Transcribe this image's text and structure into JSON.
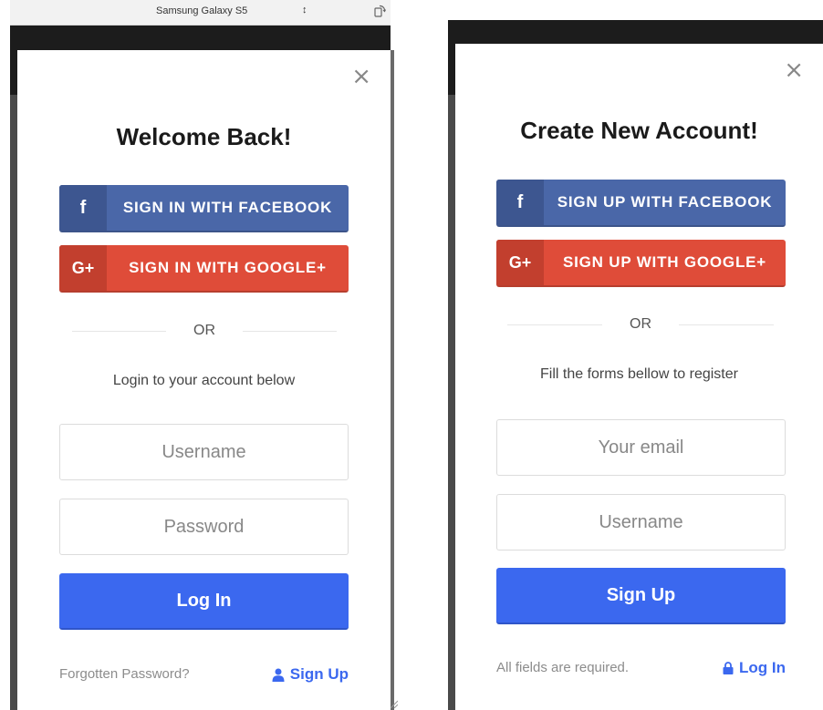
{
  "device_bar": {
    "device_name": "Samsung Galaxy S5",
    "arrows": "↕"
  },
  "login": {
    "close": "×",
    "title": "Welcome Back!",
    "facebook_icon": "f",
    "facebook_label": "SIGN IN WITH FACEBOOK",
    "google_icon": "G+",
    "google_label": "SIGN IN WITH GOOGLE+",
    "or": "OR",
    "subtitle": "Login to your account below",
    "username_placeholder": "Username",
    "password_placeholder": "Password",
    "submit_label": "Log In",
    "forgot_label": "Forgotten Password?",
    "alt_link_label": "Sign Up",
    "alt_link_icon": "user-icon"
  },
  "register": {
    "close": "×",
    "title": "Create New Account!",
    "facebook_icon": "f",
    "facebook_label": "SIGN UP WITH FACEBOOK",
    "google_icon": "G+",
    "google_label": "SIGN UP WITH GOOGLE+",
    "or": "OR",
    "subtitle": "Fill the forms bellow to register",
    "email_placeholder": "Your email",
    "username_placeholder": "Username",
    "submit_label": "Sign Up",
    "required_note": "All fields are required.",
    "alt_link_label": "Log In",
    "alt_link_icon": "lock-icon"
  },
  "colors": {
    "facebook": "#4a67a8",
    "google": "#df4c39",
    "primary": "#3b68ef"
  }
}
